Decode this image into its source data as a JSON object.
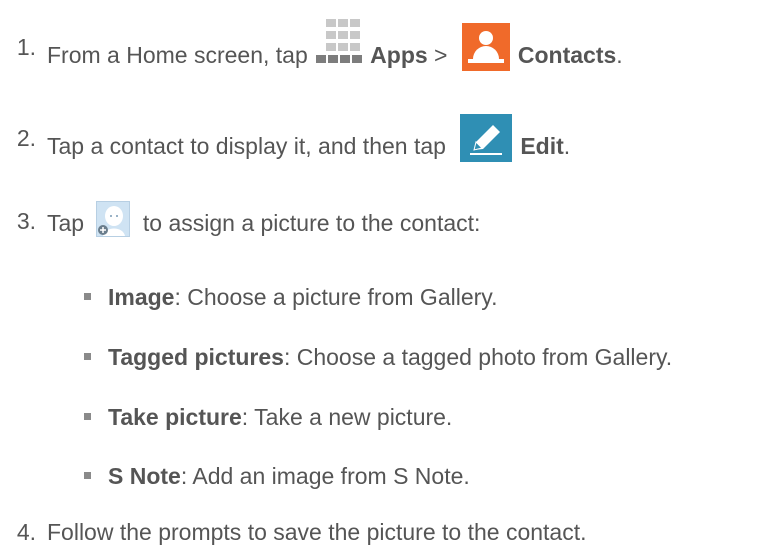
{
  "steps": [
    {
      "num": "1.",
      "pre": "From a Home screen, tap",
      "apps": "Apps",
      "sep": ">",
      "contacts": "Contacts",
      "end": "."
    },
    {
      "num": "2.",
      "pre": "Tap a contact to display it, and then tap",
      "edit": "Edit",
      "end": "."
    },
    {
      "num": "3.",
      "pre": "Tap",
      "post": "to assign a picture to the contact:"
    },
    {
      "num": "4.",
      "text": "Follow the prompts to save the picture to the contact."
    }
  ],
  "options": [
    {
      "label": "Image",
      "desc": ": Choose a picture from Gallery."
    },
    {
      "label": "Tagged pictures",
      "desc": ": Choose a tagged photo from Gallery."
    },
    {
      "label": "Take picture",
      "desc": ": Take a new picture."
    },
    {
      "label": "S Note",
      "desc": ": Add an image from S Note."
    }
  ],
  "icons": {
    "apps": "apps-grid-icon",
    "contacts": "contacts-icon",
    "edit": "edit-pencil-icon",
    "avatar": "contact-picture-icon"
  },
  "colors": {
    "text": "#555555",
    "contacts_icon": "#f06a2a",
    "edit_icon": "#2f8fb4",
    "apps_icon": "#7d7d7d"
  }
}
